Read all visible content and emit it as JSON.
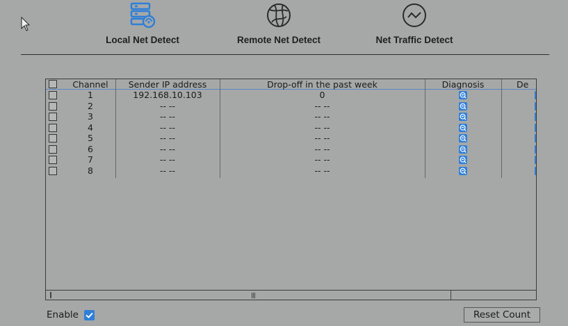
{
  "tabs": [
    {
      "label": "Local Net Detect",
      "icon": "local-net-icon",
      "color": "#2f7fd8"
    },
    {
      "label": "Remote Net Detect",
      "icon": "globe-icon",
      "color": "#2a2a2a"
    },
    {
      "label": "Net Traffic Detect",
      "icon": "traffic-chart-icon",
      "color": "#2a2a2a"
    }
  ],
  "table": {
    "headers": {
      "channel": "Channel",
      "ip": "Sender IP address",
      "drop": "Drop-off in the past week",
      "diagnosis": "Diagnosis",
      "detail": "De"
    },
    "rows": [
      {
        "channel": "1",
        "ip": "192.168.10.103",
        "drop": "0"
      },
      {
        "channel": "2",
        "ip": "-- --",
        "drop": "-- --"
      },
      {
        "channel": "3",
        "ip": "-- --",
        "drop": "-- --"
      },
      {
        "channel": "4",
        "ip": "-- --",
        "drop": "-- --"
      },
      {
        "channel": "5",
        "ip": "-- --",
        "drop": "-- --"
      },
      {
        "channel": "6",
        "ip": "-- --",
        "drop": "-- --"
      },
      {
        "channel": "7",
        "ip": "-- --",
        "drop": "-- --"
      },
      {
        "channel": "8",
        "ip": "-- --",
        "drop": "-- --"
      }
    ]
  },
  "enable": {
    "label": "Enable",
    "checked": true
  },
  "reset_button": {
    "label": "Reset Count"
  },
  "colors": {
    "accent": "#2f7fd8",
    "background": "#a6a8a7"
  }
}
